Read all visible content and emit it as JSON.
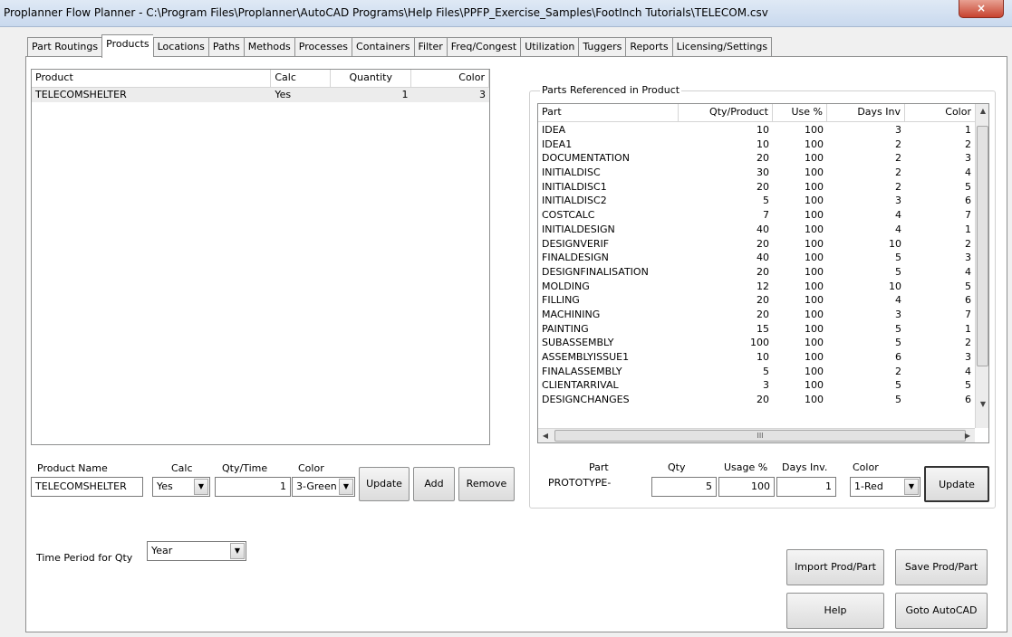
{
  "window": {
    "title": "Proplanner Flow Planner - C:\\Program Files\\Proplanner\\AutoCAD Programs\\Help Files\\PPFP_Exercise_Samples\\FootInch Tutorials\\TELECOM.csv",
    "close_glyph": "×"
  },
  "tabs": [
    {
      "label": "Part Routings"
    },
    {
      "label": "Products"
    },
    {
      "label": "Locations"
    },
    {
      "label": "Paths"
    },
    {
      "label": "Methods"
    },
    {
      "label": "Processes"
    },
    {
      "label": "Containers"
    },
    {
      "label": "Filter"
    },
    {
      "label": "Freq/Congest"
    },
    {
      "label": "Utilization"
    },
    {
      "label": "Tuggers"
    },
    {
      "label": "Reports"
    },
    {
      "label": "Licensing/Settings"
    }
  ],
  "products": {
    "columns": [
      "Product",
      "Calc",
      "Quantity",
      "Color"
    ],
    "rows": [
      {
        "product": "TELECOMSHELTER",
        "calc": "Yes",
        "quantity": "1",
        "color": "3"
      }
    ]
  },
  "product_editor": {
    "name_label": "Product Name",
    "calc_label": "Calc",
    "qty_label": "Qty/Time",
    "color_label": "Color",
    "name_value": "TELECOMSHELTER",
    "calc_value": "Yes",
    "qty_value": "1",
    "color_value": "3-Green",
    "update_btn": "Update",
    "add_btn": "Add",
    "remove_btn": "Remove"
  },
  "time_period": {
    "label": "Time Period for Qty",
    "value": "Year"
  },
  "parts_ref": {
    "group_label": "Parts Referenced in Product",
    "columns": [
      "Part",
      "Qty/Product",
      "Use %",
      "Days Inv",
      "Color"
    ],
    "rows": [
      {
        "part": "IDEA",
        "qty": "10",
        "use": "100",
        "days": "3",
        "color": "1"
      },
      {
        "part": "IDEA1",
        "qty": "10",
        "use": "100",
        "days": "2",
        "color": "2"
      },
      {
        "part": "DOCUMENTATION",
        "qty": "20",
        "use": "100",
        "days": "2",
        "color": "3"
      },
      {
        "part": "INITIALDISC",
        "qty": "30",
        "use": "100",
        "days": "2",
        "color": "4"
      },
      {
        "part": "INITIALDISC1",
        "qty": "20",
        "use": "100",
        "days": "2",
        "color": "5"
      },
      {
        "part": "INITIALDISC2",
        "qty": "5",
        "use": "100",
        "days": "3",
        "color": "6"
      },
      {
        "part": "COSTCALC",
        "qty": "7",
        "use": "100",
        "days": "4",
        "color": "7"
      },
      {
        "part": "INITIALDESIGN",
        "qty": "40",
        "use": "100",
        "days": "4",
        "color": "1"
      },
      {
        "part": "DESIGNVERIF",
        "qty": "20",
        "use": "100",
        "days": "10",
        "color": "2"
      },
      {
        "part": "FINALDESIGN",
        "qty": "40",
        "use": "100",
        "days": "5",
        "color": "3"
      },
      {
        "part": "DESIGNFINALISATION",
        "qty": "20",
        "use": "100",
        "days": "5",
        "color": "4"
      },
      {
        "part": "MOLDING",
        "qty": "12",
        "use": "100",
        "days": "10",
        "color": "5"
      },
      {
        "part": "FILLING",
        "qty": "20",
        "use": "100",
        "days": "4",
        "color": "6"
      },
      {
        "part": "MACHINING",
        "qty": "20",
        "use": "100",
        "days": "3",
        "color": "7"
      },
      {
        "part": "PAINTING",
        "qty": "15",
        "use": "100",
        "days": "5",
        "color": "1"
      },
      {
        "part": "SUBASSEMBLY",
        "qty": "100",
        "use": "100",
        "days": "5",
        "color": "2"
      },
      {
        "part": "ASSEMBLYISSUE1",
        "qty": "10",
        "use": "100",
        "days": "6",
        "color": "3"
      },
      {
        "part": "FINALASSEMBLY",
        "qty": "5",
        "use": "100",
        "days": "2",
        "color": "4"
      },
      {
        "part": "CLIENTARRIVAL",
        "qty": "3",
        "use": "100",
        "days": "5",
        "color": "5"
      },
      {
        "part": "DESIGNCHANGES",
        "qty": "20",
        "use": "100",
        "days": "5",
        "color": "6"
      }
    ],
    "scroll_mid_glyph": "III"
  },
  "part_editor": {
    "part_label": "Part",
    "qty_label": "Qty",
    "usage_label": "Usage %",
    "days_label": "Days Inv.",
    "color_label": "Color",
    "part_value": "PROTOTYPE-",
    "qty_value": "5",
    "usage_value": "100",
    "days_value": "1",
    "color_value": "1-Red",
    "update_btn": "Update"
  },
  "actions": {
    "import_btn": "Import Prod/Part",
    "save_btn": "Save Prod/Part",
    "help_btn": "Help",
    "goto_btn": "Goto AutoCAD"
  }
}
